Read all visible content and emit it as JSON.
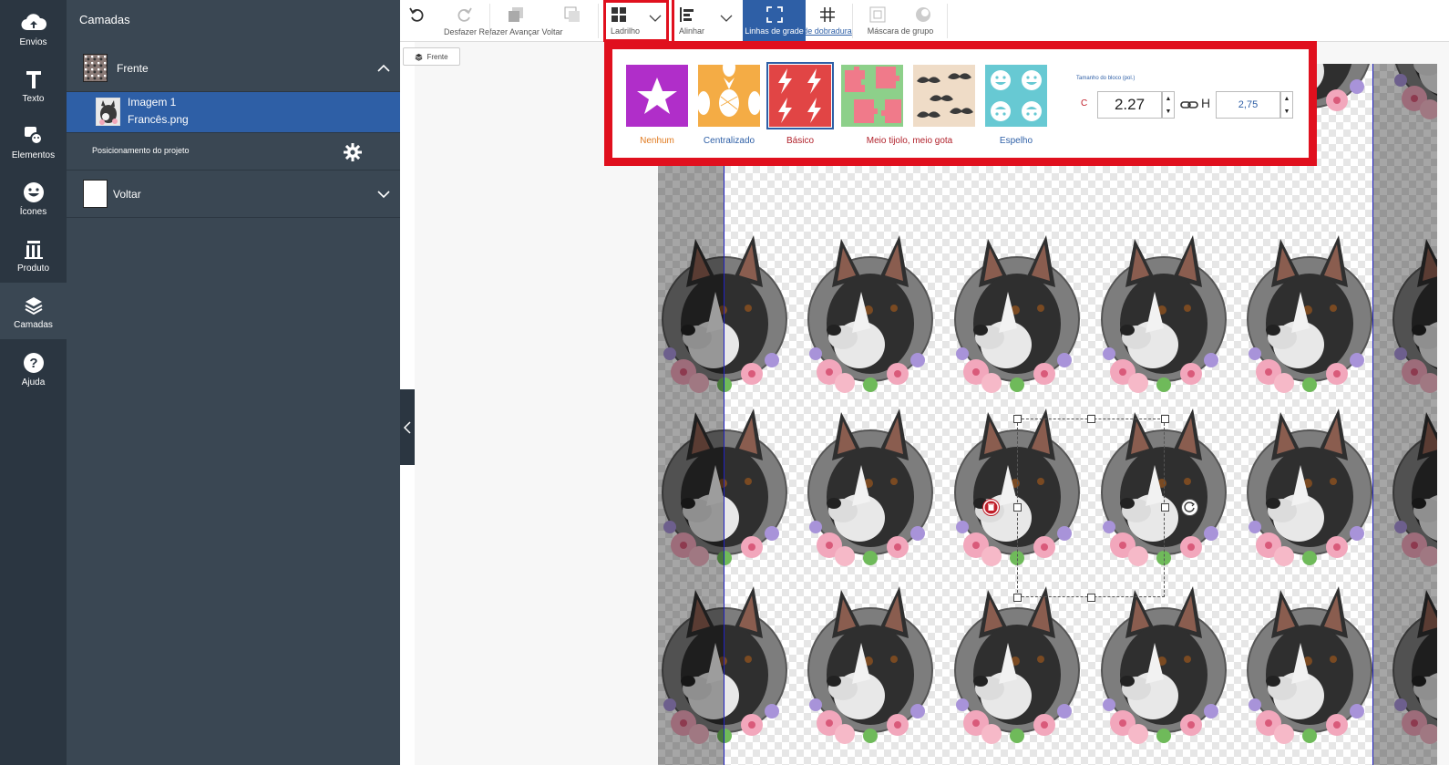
{
  "rail": {
    "items": [
      {
        "label": "Envios",
        "icon": "cloud-upload-icon"
      },
      {
        "label": "Texto",
        "icon": "text-icon"
      },
      {
        "label": "Elementos",
        "icon": "elements-icon"
      },
      {
        "label": "Ícones",
        "icon": "smiley-icon"
      },
      {
        "label": "Produto",
        "icon": "product-icon"
      },
      {
        "label": "Camadas",
        "icon": "layers-icon"
      },
      {
        "label": "Ajuda",
        "icon": "help-icon"
      }
    ],
    "active": "Camadas"
  },
  "panel": {
    "title": "Camadas",
    "front_group": "Frente",
    "image_layer": {
      "name": "Imagem 1",
      "file": "Francês.png"
    },
    "project_positioning": "Posicionamento do projeto",
    "back_group": "Voltar"
  },
  "toolbar": {
    "undo": "Desfazer",
    "redo": "Refazer",
    "forward": "Avançar",
    "back": "Voltar",
    "tile": "Ladrilho",
    "align": "Alinhar",
    "gridlines": "Linhas de grade",
    "gridlines_suffix": "de dobradura",
    "group_mask": "Máscara de grupo"
  },
  "canvas": {
    "side_tag": "Frente"
  },
  "tile_popup": {
    "options": [
      {
        "label": "Nenhum",
        "color": "#b02ec9"
      },
      {
        "label": "Centralizado",
        "color": "#f4ac45"
      },
      {
        "label": "Básico",
        "color": "#e14545"
      },
      {
        "label": "Meio tijolo, meio gota",
        "color": "#8dd08a"
      },
      {
        "label": "",
        "color": "#efdcc7"
      },
      {
        "label": "Espelho",
        "color": "#67c9d3"
      }
    ],
    "selected": "Básico",
    "size_heading": "Tamanho do bloco (pol.)",
    "width_label": "C",
    "width_value": "2.27",
    "height_label": "H",
    "height_value": "2,75"
  },
  "colors": {
    "rail_bg": "#2b3641",
    "panel_bg": "#3a4753",
    "selected_row": "#2e5fa6",
    "highlight_red": "#e0101e"
  }
}
